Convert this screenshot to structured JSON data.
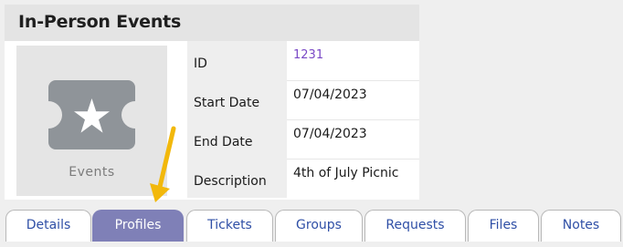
{
  "panel": {
    "title": "In-Person Events",
    "thumbnail": {
      "label": "Events",
      "icon": "ticket-star-icon"
    },
    "rows": [
      {
        "label": "ID",
        "value": "1231",
        "value_is_link": true
      },
      {
        "label": "Start Date",
        "value": "07/04/2023"
      },
      {
        "label": "End Date",
        "value": "07/04/2023"
      },
      {
        "label": "Description",
        "value": "4th of July Picnic"
      }
    ]
  },
  "tabs": [
    {
      "label": "Details",
      "active": false
    },
    {
      "label": "Profiles",
      "active": true
    },
    {
      "label": "Tickets",
      "active": false
    },
    {
      "label": "Groups",
      "active": false
    },
    {
      "label": "Requests",
      "active": false
    },
    {
      "label": "Files",
      "active": false
    },
    {
      "label": "Notes",
      "active": false
    }
  ],
  "annotation": {
    "arrow_icon": "arrow-down-icon",
    "arrow_color": "#f2b80b"
  },
  "colors": {
    "active_tab": "#7f80b7",
    "tab_text": "#2f4fa6",
    "id_link": "#7a49c6"
  }
}
